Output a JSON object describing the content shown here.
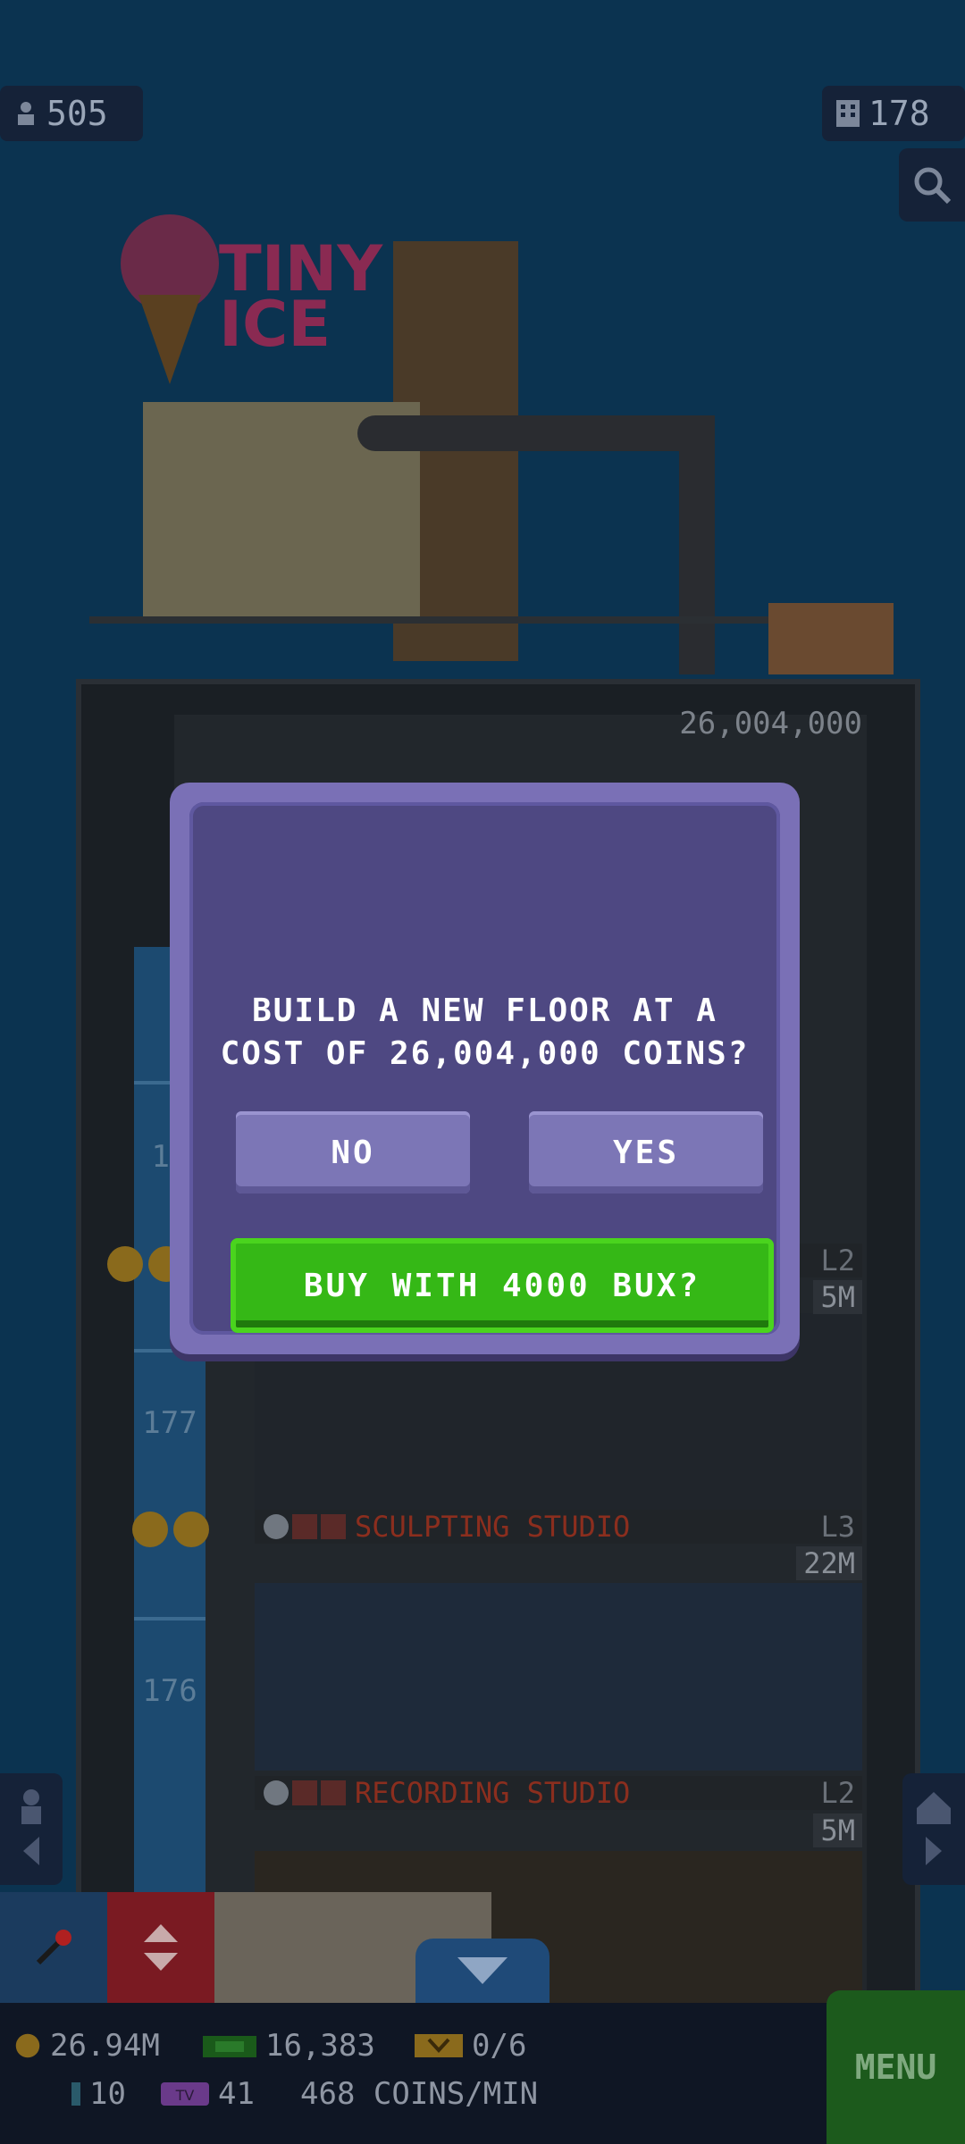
{
  "hud": {
    "population": "505",
    "floors": "178"
  },
  "tower": {
    "next_floor_price": "26,004,000",
    "floor_numbers": [
      "17",
      "177",
      "176"
    ],
    "floors": [
      {
        "name": "",
        "level": "L2",
        "price": "5M"
      },
      {
        "name": "SCULPTING STUDIO",
        "level": "L3",
        "price": "22M"
      },
      {
        "name": "RECORDING STUDIO",
        "level": "L2",
        "price": "5M"
      }
    ],
    "logo_line1": "TINY",
    "logo_line2": "ICE"
  },
  "dialog": {
    "message_line1": "BUILD A NEW FLOOR AT A",
    "message_line2": "COST OF 26,004,000 COINS?",
    "no_label": "NO",
    "yes_label": "YES",
    "bux_label": "BUY WITH 4000 BUX?"
  },
  "bottom_bar": {
    "coins": "26.94M",
    "bux": "16,383",
    "vip": "0/6",
    "tickets": "10",
    "tv": "41",
    "rate": "468 COINS/MIN",
    "menu_label": "MENU"
  },
  "colors": {
    "dialog_bg": "#4e4882",
    "dialog_border": "#7a70b6",
    "bux_button": "#35b816",
    "menu_button": "#1c5a1c"
  }
}
